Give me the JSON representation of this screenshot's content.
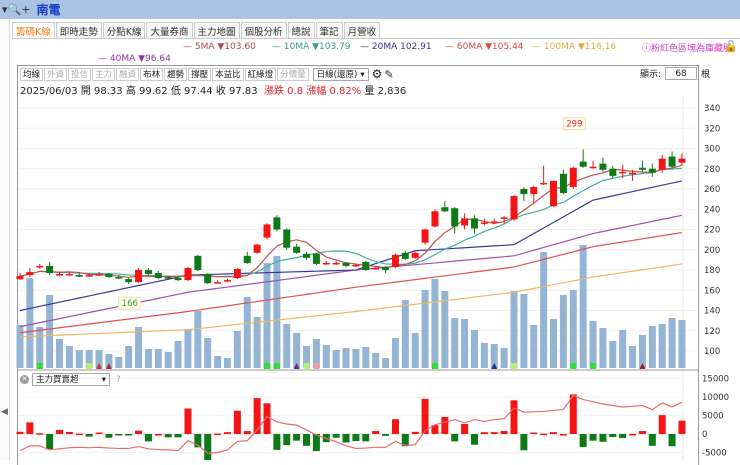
{
  "header": {
    "title": "南電",
    "zoom_icon": "magnifier-plus-icon"
  },
  "tabs": [
    "籌碼K線",
    "即時走勢",
    "分點K線",
    "大量券商",
    "主力地圖",
    "個股分析",
    "總說",
    "筆記",
    "月營收"
  ],
  "legend": {
    "ma5": "5MA ▼103.60",
    "ma10": "10MA ▼103.79",
    "ma20": "20MA 102.91",
    "ma60": "60MA ▼105.44",
    "ma100": "100MA ▼116.16",
    "ma40": "40MA ▼96.64"
  },
  "notice": "粉紅色區塊為庫藏股",
  "toolbar": {
    "buttons": [
      {
        "label": "均線",
        "enabled": true
      },
      {
        "label": "外資",
        "enabled": false
      },
      {
        "label": "投信",
        "enabled": false
      },
      {
        "label": "主力",
        "enabled": false
      },
      {
        "label": "融資",
        "enabled": false
      },
      {
        "label": "布林",
        "enabled": true
      },
      {
        "label": "趨勢",
        "enabled": true
      },
      {
        "label": "撐壓",
        "enabled": true
      },
      {
        "label": "本益比",
        "enabled": true
      },
      {
        "label": "紅綠燈",
        "enabled": true
      },
      {
        "label": "分價量",
        "enabled": false
      }
    ],
    "period": "日線(還原)",
    "show_label": "顯示:",
    "show_count": "68",
    "show_unit": "根"
  },
  "info": {
    "date": "2025/06/03",
    "open": "開 98.33",
    "high": "高 99.62",
    "low": "低 97.44",
    "close": "收 97.83",
    "change": "漲跌 0.8",
    "pct": "漲幅 0.82%",
    "volume": "量 2,836"
  },
  "indicator": {
    "name": "主力買賣超",
    "help": "?"
  },
  "colors": {
    "up": "#f51414",
    "down": "#0c7a16",
    "volume": "#94b4d6",
    "ma5": "#c05050",
    "ma10": "#40b0a0",
    "ma20": "#3838a0",
    "ma40": "#a050b0",
    "ma60": "#e05050",
    "ma100": "#f0b860",
    "cum": "#e86a6a"
  },
  "chart_data": {
    "type": "candlestick",
    "price_axis": {
      "ticks": [
        340,
        320,
        300,
        280,
        260,
        240,
        220,
        200,
        180,
        160,
        140,
        120,
        100
      ],
      "range": [
        93,
        340
      ]
    },
    "indicator_axis": {
      "ticks": [
        15000,
        10000,
        5000,
        0,
        -5000
      ],
      "labels": [
        "15000",
        "10000",
        "5000",
        "0",
        "-5000"
      ]
    },
    "annotations": [
      {
        "index": 11,
        "label": "166",
        "type": "low"
      },
      {
        "index": 56,
        "label": "299",
        "type": "high"
      }
    ],
    "ohlc": [
      [
        171,
        177,
        170,
        174
      ],
      [
        175,
        182,
        173,
        178
      ],
      [
        183,
        186,
        181,
        184
      ],
      [
        184,
        188,
        175,
        177
      ],
      [
        176,
        178,
        174,
        176
      ],
      [
        176,
        178,
        174,
        176
      ],
      [
        175,
        177,
        173,
        174
      ],
      [
        175,
        177,
        173,
        175
      ],
      [
        176,
        178,
        174,
        176
      ],
      [
        176,
        177,
        172,
        173
      ],
      [
        173,
        175,
        171,
        172
      ],
      [
        171,
        172,
        166,
        168
      ],
      [
        168,
        182,
        167,
        180
      ],
      [
        180,
        182,
        175,
        176
      ],
      [
        177,
        179,
        171,
        172
      ],
      [
        173,
        174,
        171,
        172
      ],
      [
        172,
        174,
        169,
        170
      ],
      [
        170,
        183,
        169,
        182
      ],
      [
        194,
        195,
        179,
        180
      ],
      [
        176,
        177,
        166,
        167
      ],
      [
        168,
        170,
        167,
        168
      ],
      [
        169,
        171,
        168,
        170
      ],
      [
        172,
        182,
        171,
        181
      ],
      [
        194,
        198,
        186,
        187
      ],
      [
        197,
        206,
        196,
        205
      ],
      [
        212,
        226,
        210,
        225
      ],
      [
        232,
        234,
        218,
        220
      ],
      [
        220,
        221,
        200,
        202
      ],
      [
        203,
        206,
        196,
        197
      ],
      [
        196,
        198,
        190,
        192
      ],
      [
        196,
        197,
        185,
        186
      ],
      [
        187,
        189,
        185,
        187
      ],
      [
        187,
        189,
        185,
        187
      ],
      [
        187,
        188,
        183,
        184
      ],
      [
        185,
        186,
        183,
        185
      ],
      [
        188,
        189,
        179,
        180
      ],
      [
        182,
        183,
        181,
        182
      ],
      [
        183,
        184,
        177,
        180
      ],
      [
        183,
        196,
        182,
        195
      ],
      [
        197,
        199,
        190,
        191
      ],
      [
        192,
        198,
        191,
        197
      ],
      [
        207,
        221,
        205,
        220
      ],
      [
        223,
        240,
        222,
        238
      ],
      [
        242,
        248,
        237,
        238
      ],
      [
        241,
        242,
        216,
        223
      ],
      [
        224,
        236,
        220,
        231
      ],
      [
        231,
        234,
        216,
        221
      ],
      [
        227,
        231,
        224,
        227
      ],
      [
        228,
        231,
        225,
        228
      ],
      [
        232,
        233,
        226,
        232
      ],
      [
        230,
        254,
        229,
        253
      ],
      [
        260,
        262,
        248,
        255
      ],
      [
        255,
        263,
        246,
        262
      ],
      [
        266,
        283,
        264,
        266
      ],
      [
        243,
        268,
        242,
        268
      ],
      [
        275,
        279,
        255,
        256
      ],
      [
        262,
        282,
        260,
        281
      ],
      [
        287,
        299,
        281,
        282
      ],
      [
        282,
        288,
        280,
        282
      ],
      [
        285,
        291,
        277,
        279
      ],
      [
        280,
        283,
        271,
        273
      ],
      [
        277,
        284,
        271,
        277
      ],
      [
        276,
        279,
        268,
        276
      ],
      [
        281,
        288,
        277,
        279
      ],
      [
        280,
        285,
        272,
        276
      ],
      [
        279,
        294,
        276,
        290
      ],
      [
        292,
        297,
        281,
        282
      ],
      [
        286,
        295,
        283,
        290
      ]
    ],
    "volume": [
      43,
      90,
      41,
      73,
      29,
      22,
      18,
      18,
      18,
      14,
      11,
      22,
      41,
      19,
      19,
      16,
      27,
      39,
      57,
      30,
      12,
      10,
      37,
      71,
      51,
      105,
      112,
      44,
      35,
      22,
      29,
      23,
      18,
      20,
      19,
      21,
      15,
      10,
      30,
      68,
      35,
      78,
      89,
      77,
      50,
      49,
      38,
      25,
      24,
      20,
      77,
      74,
      43,
      116,
      49,
      73,
      78,
      123,
      47,
      40,
      27,
      38,
      22,
      33,
      42,
      44,
      50,
      48
    ],
    "ma_anchors": {
      "ma20": [
        [
          0,
          140
        ],
        [
          17,
          175
        ],
        [
          34,
          180
        ],
        [
          40,
          199
        ],
        [
          50,
          205
        ],
        [
          58,
          249
        ],
        [
          67,
          268
        ]
      ],
      "ma40": [
        [
          0,
          124
        ],
        [
          17,
          158
        ],
        [
          34,
          180
        ],
        [
          50,
          194
        ],
        [
          58,
          216
        ],
        [
          67,
          234
        ]
      ],
      "ma60": [
        [
          0,
          118
        ],
        [
          17,
          139
        ],
        [
          34,
          163
        ],
        [
          50,
          183
        ],
        [
          58,
          203
        ],
        [
          67,
          217
        ]
      ],
      "ma100": [
        [
          0,
          114
        ],
        [
          17,
          121
        ],
        [
          34,
          139
        ],
        [
          50,
          158
        ],
        [
          58,
          173
        ],
        [
          67,
          186
        ]
      ]
    },
    "main_force": [
      600,
      3150,
      200,
      -4100,
      1100,
      550,
      100,
      -700,
      400,
      -1000,
      -100,
      -100,
      900,
      -2000,
      0,
      -900,
      -900,
      6900,
      -3600,
      -7600,
      100,
      500,
      6300,
      800,
      9700,
      8300,
      -4300,
      -3000,
      -1800,
      -3200,
      -4600,
      -2200,
      -1000,
      -2300,
      -1900,
      -2000,
      800,
      -500,
      4000,
      -3300,
      600,
      9500,
      2400,
      4600,
      -2000,
      2700,
      -2900,
      500,
      500,
      800,
      9100,
      -4400,
      400,
      100,
      500,
      0,
      10700,
      -3500,
      -1800,
      -2100,
      -800,
      -1100,
      0,
      800,
      -3200,
      5100,
      -3300,
      3600
    ],
    "main_force_line": [
      -4500,
      -3200,
      -3200,
      -4300,
      -4000,
      -3700,
      -3600,
      -3700,
      -3600,
      -3800,
      -3900,
      -3900,
      -3400,
      -4000,
      -4200,
      -4300,
      -4500,
      -1800,
      -3000,
      -5200,
      -5000,
      -4300,
      -2000,
      -1800,
      1100,
      4700,
      3300,
      2700,
      2400,
      1100,
      -300,
      -1200,
      -2100,
      -3200,
      -3900,
      -3800,
      -3600,
      -3600,
      -2000,
      -3100,
      -2900,
      900,
      2500,
      3200,
      3900,
      3000,
      3900,
      3400,
      3900,
      4100,
      7000,
      5900,
      6000,
      6100,
      6400,
      6600,
      10400,
      9300,
      8700,
      8100,
      7700,
      7300,
      7500,
      7700,
      6600,
      8400,
      7300,
      8600
    ],
    "markers": [
      {
        "index": 2,
        "shape": "square",
        "color": "#33dd33"
      },
      {
        "index": 7,
        "shape": "square",
        "color": "#b8f070"
      },
      {
        "index": 8,
        "shape": "triangle",
        "color": "#d03030"
      },
      {
        "index": 9,
        "shape": "triangle",
        "color": "#a03040"
      },
      {
        "index": 25,
        "shape": "square",
        "color": "#33dd33"
      },
      {
        "index": 26,
        "shape": "square",
        "color": "#33dd33"
      },
      {
        "index": 28,
        "shape": "triangle",
        "color": "#702090"
      },
      {
        "index": 29,
        "shape": "square",
        "color": "#b8f070"
      },
      {
        "index": 30,
        "shape": "square",
        "color": "#f0a0a0"
      },
      {
        "index": 42,
        "shape": "square",
        "color": "#33dd33"
      },
      {
        "index": 48,
        "shape": "triangle",
        "color": "#203090"
      },
      {
        "index": 50,
        "shape": "square",
        "color": "#b8f070"
      },
      {
        "index": 56,
        "shape": "square",
        "color": "#33dd33"
      },
      {
        "index": 58,
        "shape": "square",
        "color": "#33dd33"
      },
      {
        "index": 63,
        "shape": "triangle",
        "color": "#902030"
      }
    ]
  }
}
